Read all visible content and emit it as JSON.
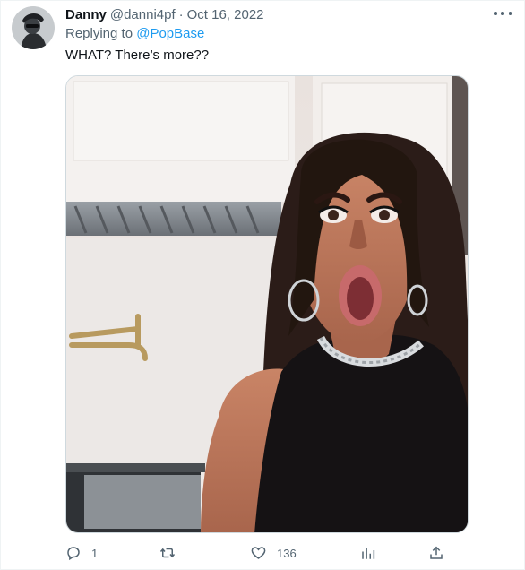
{
  "tweet": {
    "display_name": "Danny",
    "handle": "@danni4pf",
    "separator": "·",
    "date": "Oct 16, 2022",
    "replying_prefix": "Replying to",
    "replying_to": "@PopBase",
    "text": "WHAT? There’s more??"
  },
  "media": {
    "description_icon": "photo-of-shocked-woman-in-kitchen"
  },
  "actions": {
    "reply_count": "1",
    "retweet_count": "",
    "like_count": "136",
    "reply_icon": "reply-icon",
    "retweet_icon": "retweet-icon",
    "like_icon": "heart-icon",
    "analytics_icon": "analytics-icon",
    "share_icon": "share-icon"
  },
  "colors": {
    "link": "#1d9bf0",
    "secondary_text": "#536471",
    "primary_text": "#0f1419"
  }
}
